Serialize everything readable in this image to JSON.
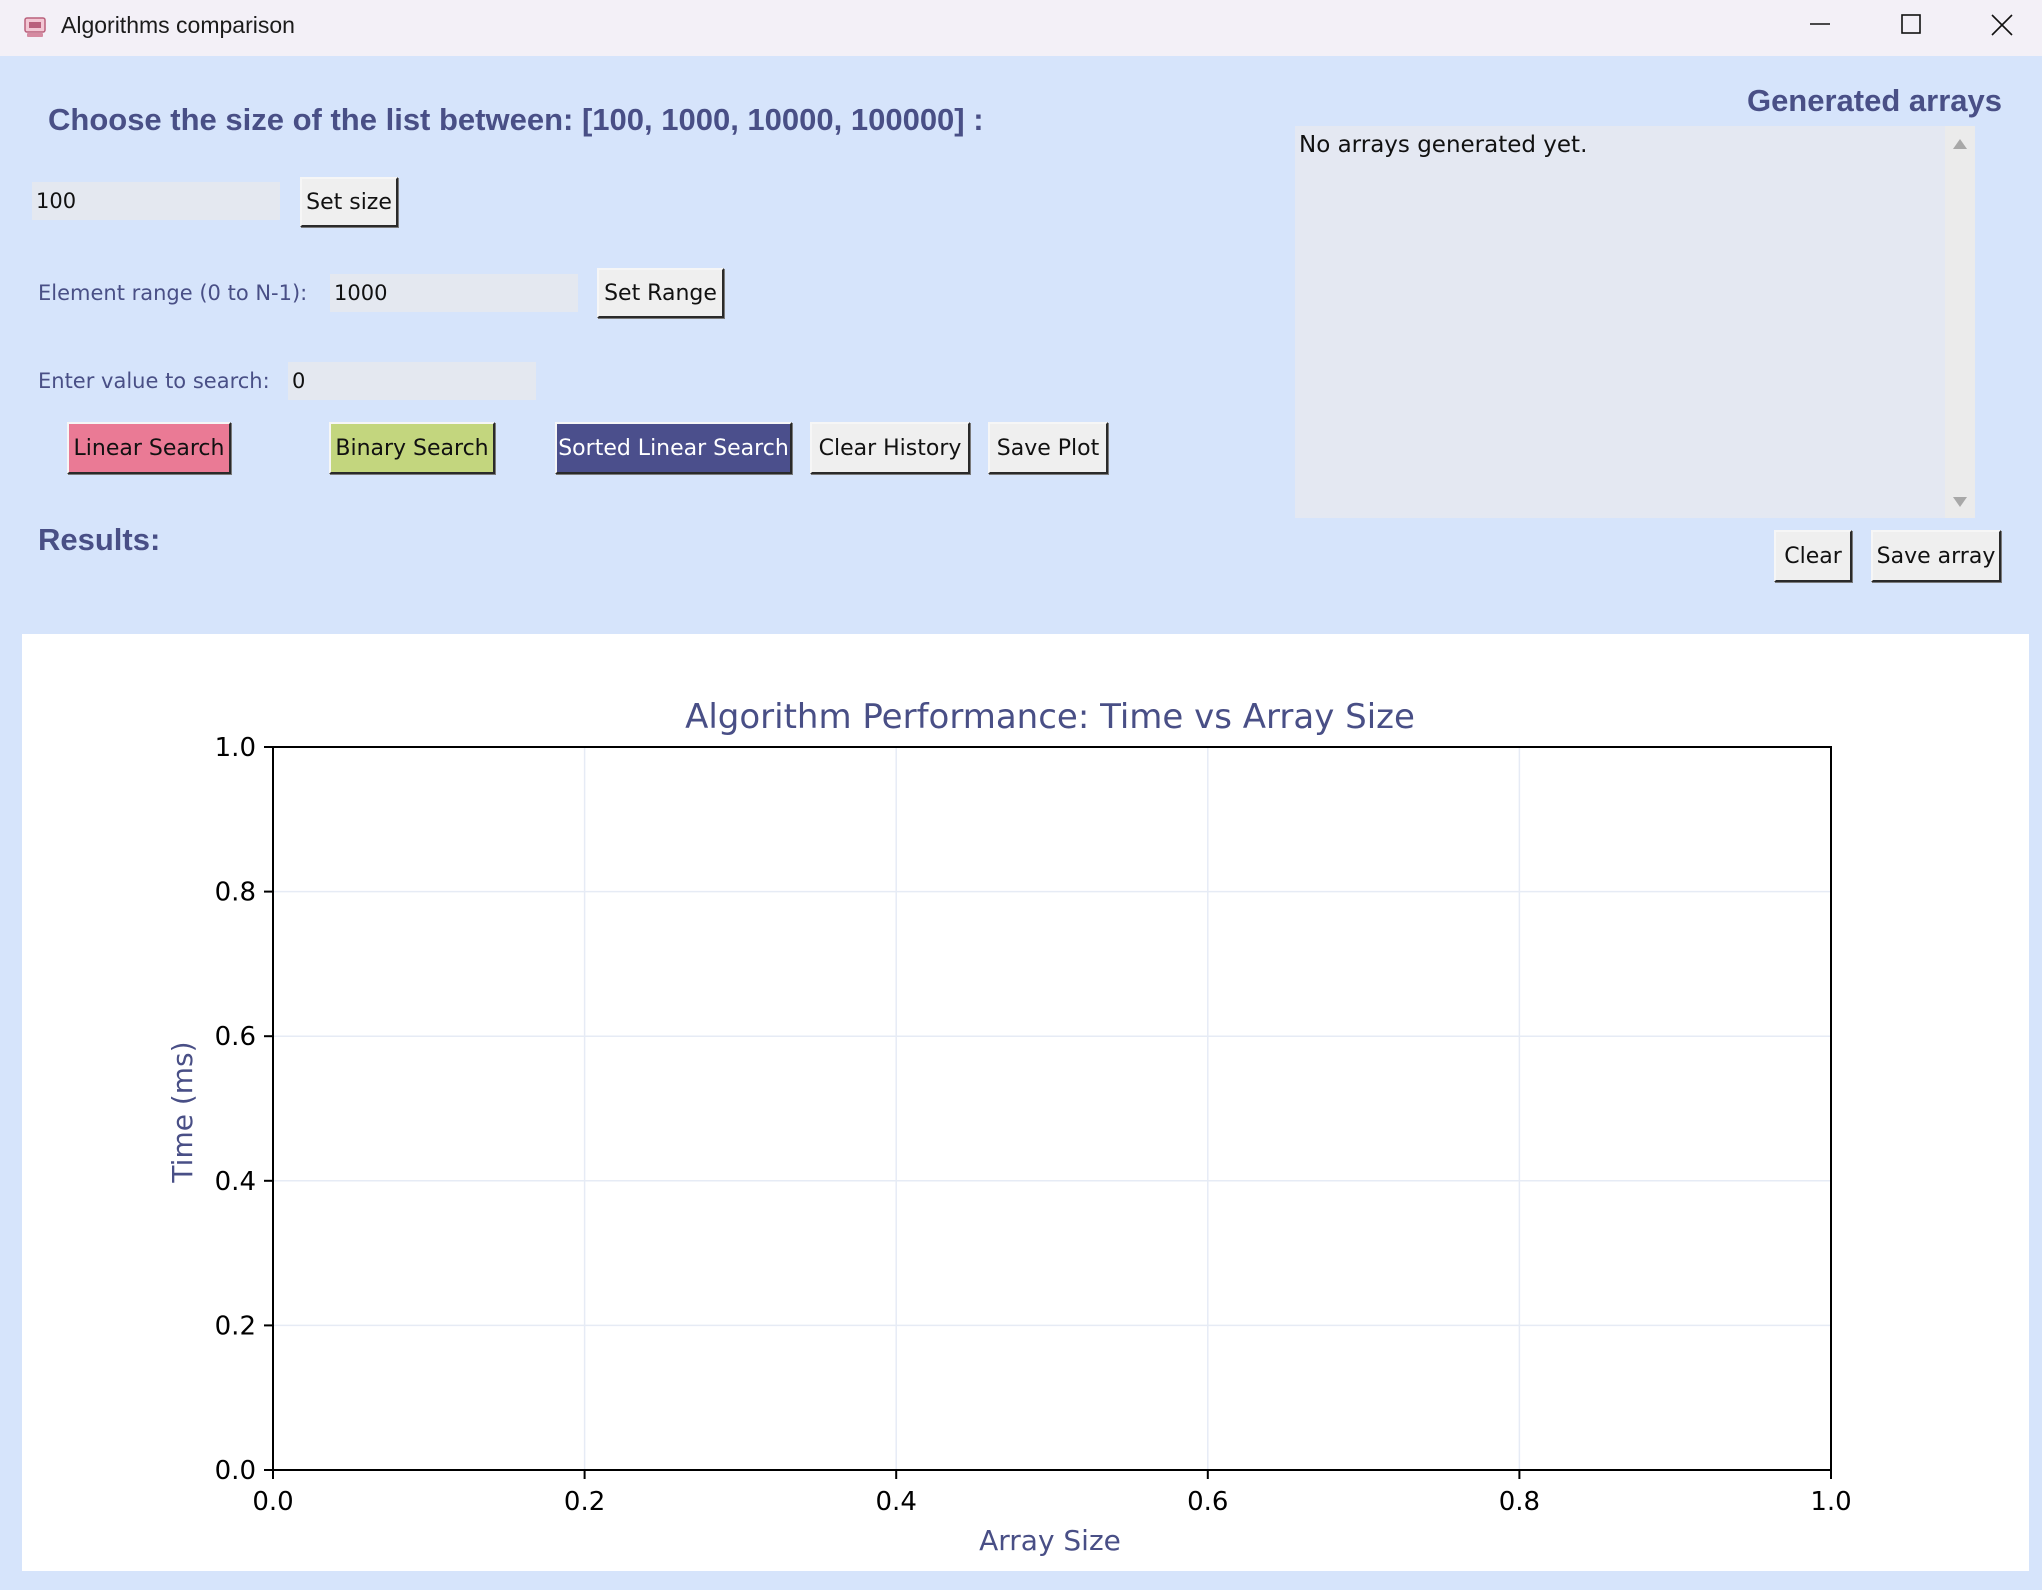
{
  "window": {
    "title": "Algorithms comparison",
    "app_icon": "app-icon",
    "controls": {
      "minimize": "minimize-icon",
      "maximize": "maximize-icon",
      "close": "close-icon"
    }
  },
  "size_section": {
    "prompt": "Choose the size of the list between: [100, 1000, 10000, 100000] :",
    "size_value": "100",
    "set_size_label": "Set size"
  },
  "range_section": {
    "label": "Element range (0 to N-1):",
    "value": "1000",
    "set_range_label": "Set Range"
  },
  "search_section": {
    "label": "Enter value to search:",
    "value": "0"
  },
  "actions": {
    "linear_search": "Linear Search",
    "binary_search": "Binary Search",
    "sorted_linear_search": "Sorted Linear Search",
    "clear_history": "Clear History",
    "save_plot": "Save Plot"
  },
  "results_label": "Results:",
  "arrays_panel": {
    "title": "Generated arrays",
    "content": "No arrays generated yet.",
    "clear_label": "Clear",
    "save_label": "Save array"
  },
  "colors": {
    "background": "#d6e4fb",
    "label_text": "#494f86",
    "linear_button": "#ea7a95",
    "binary_button": "#c3d67e",
    "sorted_button": "#4b4f8c"
  },
  "chart_data": {
    "type": "line",
    "title": "Algorithm Performance: Time vs Array Size",
    "xlabel": "Array Size",
    "ylabel": "Time (ms)",
    "xlim": [
      0.0,
      1.0
    ],
    "ylim": [
      0.0,
      1.0
    ],
    "xticks": [
      "0.0",
      "0.2",
      "0.4",
      "0.6",
      "0.8",
      "1.0"
    ],
    "yticks": [
      "0.0",
      "0.2",
      "0.4",
      "0.6",
      "0.8",
      "1.0"
    ],
    "grid": true,
    "series": []
  }
}
